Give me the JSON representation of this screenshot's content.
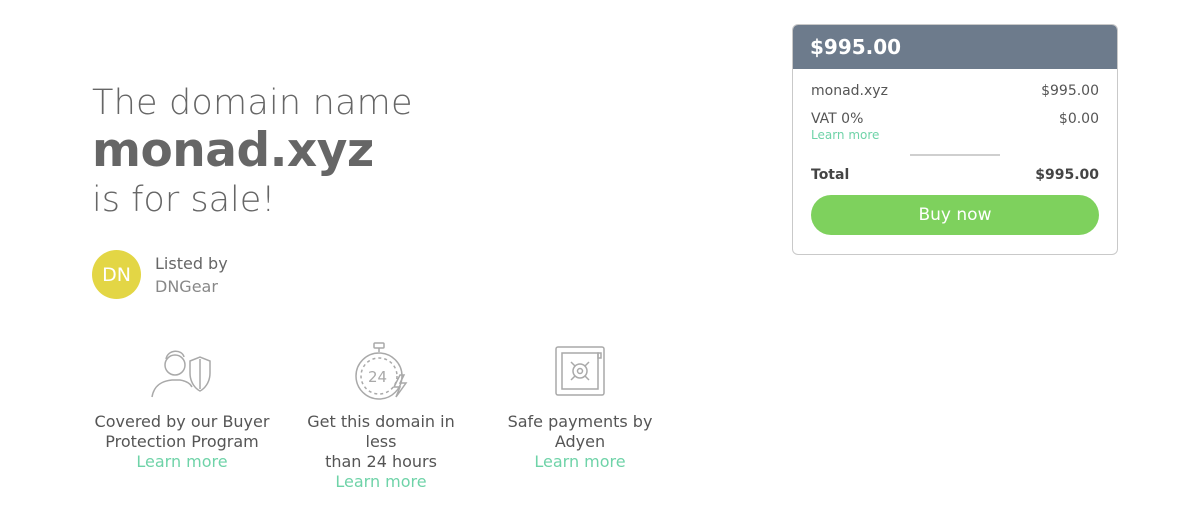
{
  "hero": {
    "line1": "The domain name",
    "domain": "monad.xyz",
    "line3": "is for sale!"
  },
  "seller": {
    "initials": "DN",
    "listed_by": "Listed by",
    "name": "DNGear",
    "avatar_color": "#e3d645"
  },
  "features": [
    {
      "icon": "buyer-protection-icon",
      "line1": "Covered by our Buyer",
      "line2": "Protection Program",
      "link": "Learn more"
    },
    {
      "icon": "stopwatch-24-icon",
      "line1": "Get this domain in less",
      "line2": "than 24 hours",
      "link": "Learn more"
    },
    {
      "icon": "safe-icon",
      "line1": "Safe payments by",
      "line2": "Adyen",
      "link": "Learn more"
    }
  ],
  "card": {
    "header_price": "$995.00",
    "item_name": "monad.xyz",
    "item_price": "$995.00",
    "vat_label": "VAT 0%",
    "vat_value": "$0.00",
    "vat_link": "Learn more",
    "total_label": "Total",
    "total_value": "$995.00",
    "buy_label": "Buy now",
    "header_color": "#6d7b8c",
    "button_color": "#7ed15d",
    "link_color": "#6fd3a8"
  }
}
